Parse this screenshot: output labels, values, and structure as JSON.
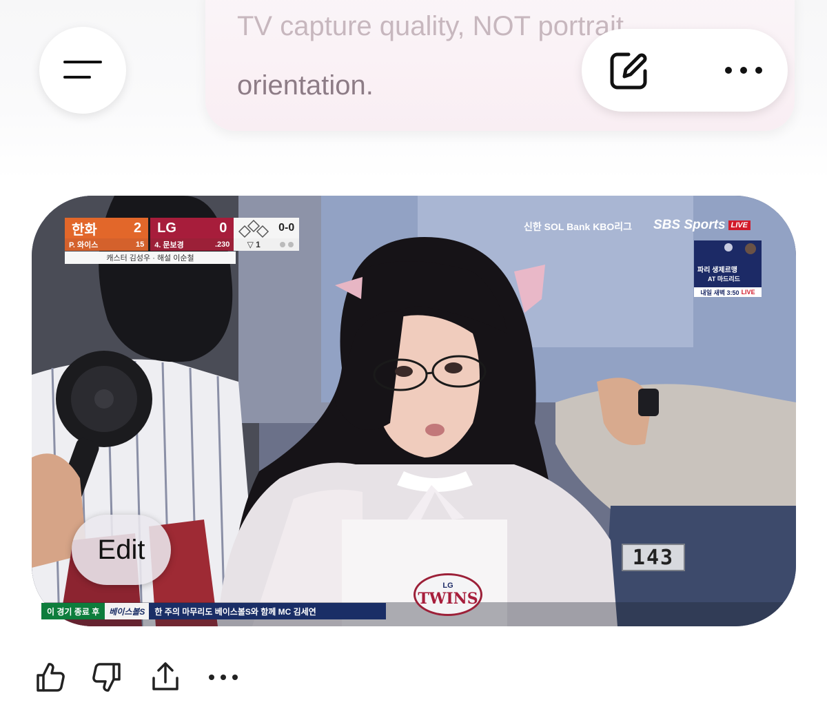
{
  "prompt": {
    "line1": "TV capture quality, NOT portrait",
    "line2": "orientation."
  },
  "header": {
    "menu_icon": "menu-icon",
    "compose_icon": "compose-icon",
    "more_icon": "more-icon"
  },
  "image": {
    "edit_label": "Edit",
    "scoreboard": {
      "team1": "한화",
      "team1_score": "2",
      "team2": "LG",
      "team2_score": "0",
      "count": "0-0",
      "pitcher": "P. 와이스",
      "pitcher_num": "15",
      "batter": "4. 문보경",
      "batter_avg": ".230",
      "outs": "▽ 1",
      "casters": "캐스터 김성우 · 해설 이순철"
    },
    "league_bug": "신한 SOL Bank KBO리그",
    "network": "SBS Sports",
    "live": "LIVE",
    "promo": {
      "line1": "파리 생제르맹",
      "line2": "AT 마드리드",
      "time": "내일 새벽 3:50",
      "live": "LIVE"
    },
    "ticker": {
      "a": "이 경기 종료 후",
      "b": "베이스볼S",
      "c": "한 주의 마무리도 베이스볼S와 함께 MC 김세연"
    },
    "seat_number": "143",
    "jersey_logo_top": "LG",
    "jersey_logo": "TWINS"
  },
  "actions": {
    "thumbs_up": "thumbs-up-icon",
    "thumbs_down": "thumbs-down-icon",
    "share": "share-icon",
    "more": "more-icon"
  }
}
